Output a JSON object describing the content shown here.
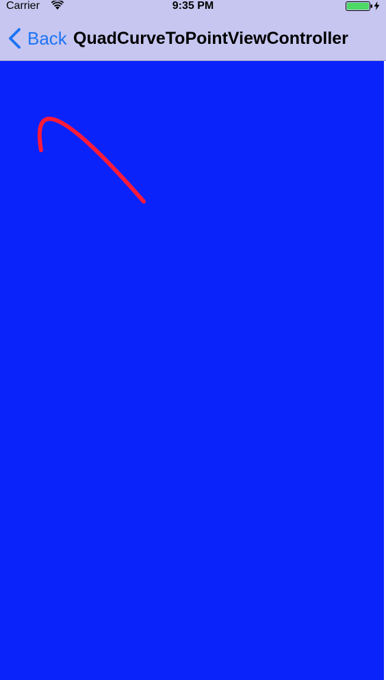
{
  "status_bar": {
    "carrier": "Carrier",
    "time": "9:35 PM",
    "icons": [
      "wifi-icon",
      "battery-icon",
      "charging-icon"
    ],
    "battery_color": "#4cd964"
  },
  "nav_bar": {
    "back_label": "Back",
    "title": "QuadCurveToPointViewController",
    "tint_color": "#1d74f5",
    "background_color": "#c6c6f0"
  },
  "content": {
    "background_color": "#0b23fb",
    "curve_color": "#ff1a3a"
  }
}
